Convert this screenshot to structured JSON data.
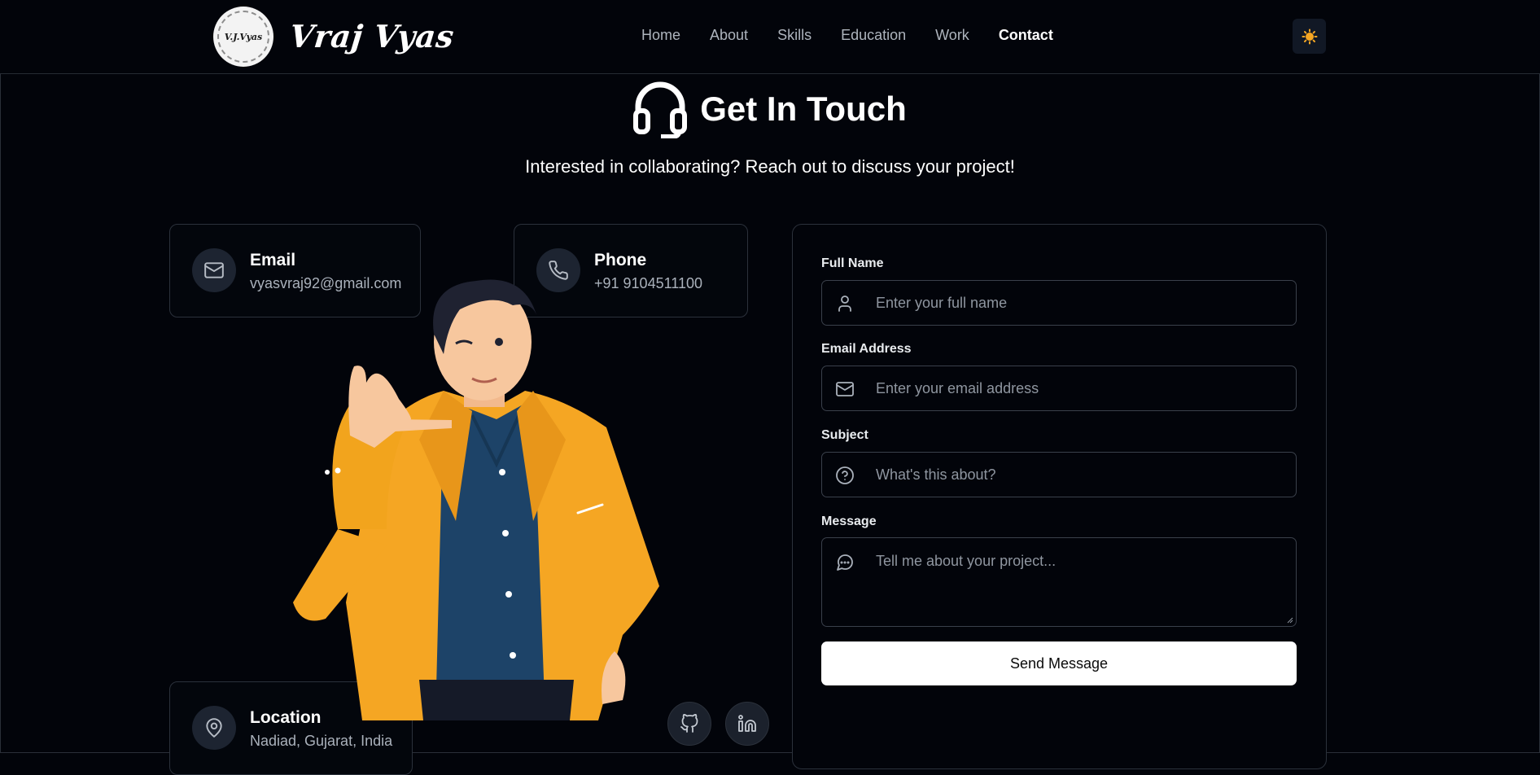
{
  "header": {
    "logo_text": "V.J.Vyas",
    "brand_name": "Vraj Vyas",
    "nav": [
      {
        "label": "Home",
        "active": false
      },
      {
        "label": "About",
        "active": false
      },
      {
        "label": "Skills",
        "active": false
      },
      {
        "label": "Education",
        "active": false
      },
      {
        "label": "Work",
        "active": false
      },
      {
        "label": "Contact",
        "active": true
      }
    ],
    "theme_icon": "sun-icon"
  },
  "section": {
    "title": "Get In Touch",
    "title_icon": "headset-icon",
    "subtitle": "Interested in collaborating? Reach out to discuss your project!"
  },
  "contact": {
    "email": {
      "label": "Email",
      "value": "vyasvraj92@gmail.com",
      "icon": "mail-icon"
    },
    "phone": {
      "label": "Phone",
      "value": "+91 9104511100",
      "icon": "phone-icon"
    },
    "location": {
      "label": "Location",
      "value": "Nadiad, Gujarat, India",
      "icon": "map-pin-icon"
    },
    "social": [
      {
        "name": "github",
        "icon": "github-icon"
      },
      {
        "name": "linkedin",
        "icon": "linkedin-icon"
      }
    ]
  },
  "form": {
    "name": {
      "label": "Full Name",
      "placeholder": "Enter your full name",
      "value": "",
      "icon": "user-icon"
    },
    "email": {
      "label": "Email Address",
      "placeholder": "Enter your email address",
      "value": "",
      "icon": "mail-icon"
    },
    "subject": {
      "label": "Subject",
      "placeholder": "What's this about?",
      "value": "",
      "icon": "help-circle-icon"
    },
    "message": {
      "label": "Message",
      "placeholder": "Tell me about your project...",
      "value": "",
      "icon": "message-circle-icon"
    },
    "submit_label": "Send Message"
  },
  "colors": {
    "background": "#02040a",
    "accent_jacket": "#f5a623",
    "shirt": "#1d4368",
    "text": "#ffffff",
    "muted": "#aab1bb"
  }
}
